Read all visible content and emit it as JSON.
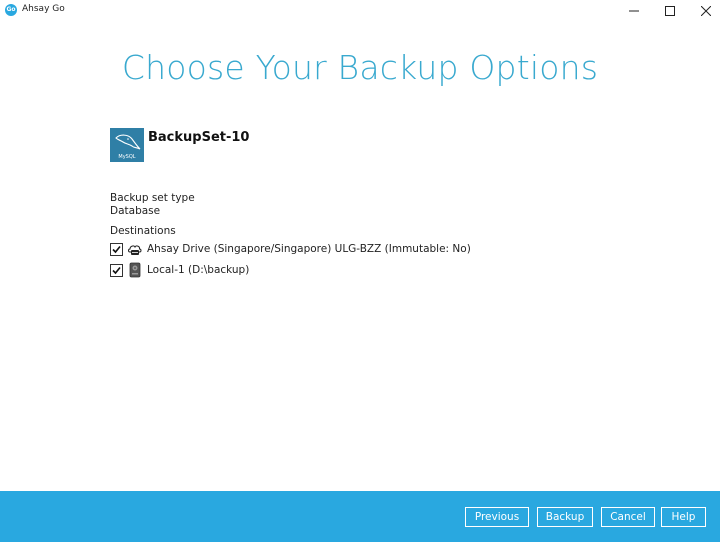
{
  "window": {
    "app_icon_text": "Go",
    "title": "Ahsay Go"
  },
  "page": {
    "heading": "Choose Your Backup Options"
  },
  "backup_set": {
    "name": "BackupSet-10",
    "icon": "mysql-icon",
    "icon_caption": "MySQL",
    "type_label": "Backup set type",
    "type_value": "Database"
  },
  "destinations": {
    "label": "Destinations",
    "items": [
      {
        "label": "Ahsay Drive (Singapore/Singapore) ULG-BZZ (Immutable: No)",
        "checked": true,
        "icon": "cloud-drive-icon"
      },
      {
        "label": "Local-1 (D:\\backup)",
        "checked": true,
        "icon": "local-disk-icon"
      }
    ]
  },
  "footer": {
    "previous": "Previous",
    "backup": "Backup",
    "cancel": "Cancel",
    "help": "Help"
  },
  "colors": {
    "accent": "#29a8e0",
    "heading": "#39a9cf",
    "mysql_tile": "#2f7fa6"
  }
}
